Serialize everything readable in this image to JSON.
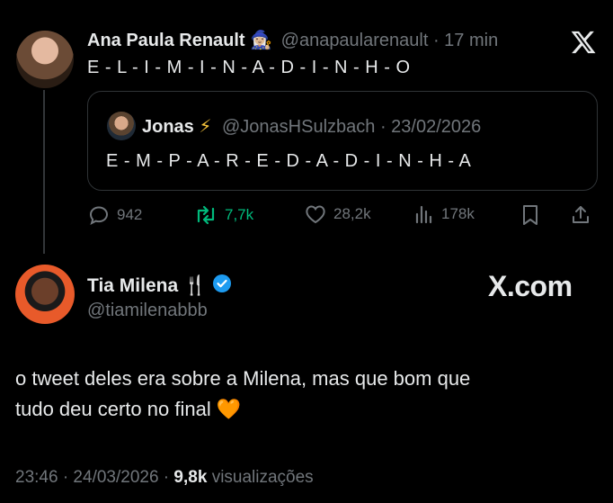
{
  "tweet1": {
    "author_name": "Ana Paula Renault",
    "author_emoji": "🧙🏼‍♀️",
    "handle": "@anapaularenault",
    "time": "· 17 min",
    "text": "E - L - I - M - I - N - A - D - I - N - H - O",
    "quote": {
      "author_name": "Jonas",
      "author_emoji": "⚡",
      "handle": "@JonasHSulzbach",
      "date": "· 23/02/2026",
      "text": "E - M - P - A - R - E - D - A - D - I - N - H - A"
    },
    "actions": {
      "replies": "942",
      "reposts": "7,7k",
      "likes": "28,2k",
      "views": "178k"
    }
  },
  "tweet2": {
    "author_name": "Tia Milena",
    "author_emoji": "🍴",
    "handle": "@tiamilenabbb",
    "watermark": "X.com",
    "text_line1": "o tweet deles era sobre a Milena, mas que bom que",
    "text_line2": "tudo deu certo no final",
    "text_emoji": "🧡",
    "timestamp": "23:46 · 24/03/2026 ·",
    "views_count": "9,8k",
    "views_label": "visualizações"
  },
  "colors": {
    "background": "#000000",
    "text": "#e7e9ea",
    "muted": "#71767b",
    "repost_green": "#00ba7c",
    "verified_blue": "#1d9bf0"
  }
}
